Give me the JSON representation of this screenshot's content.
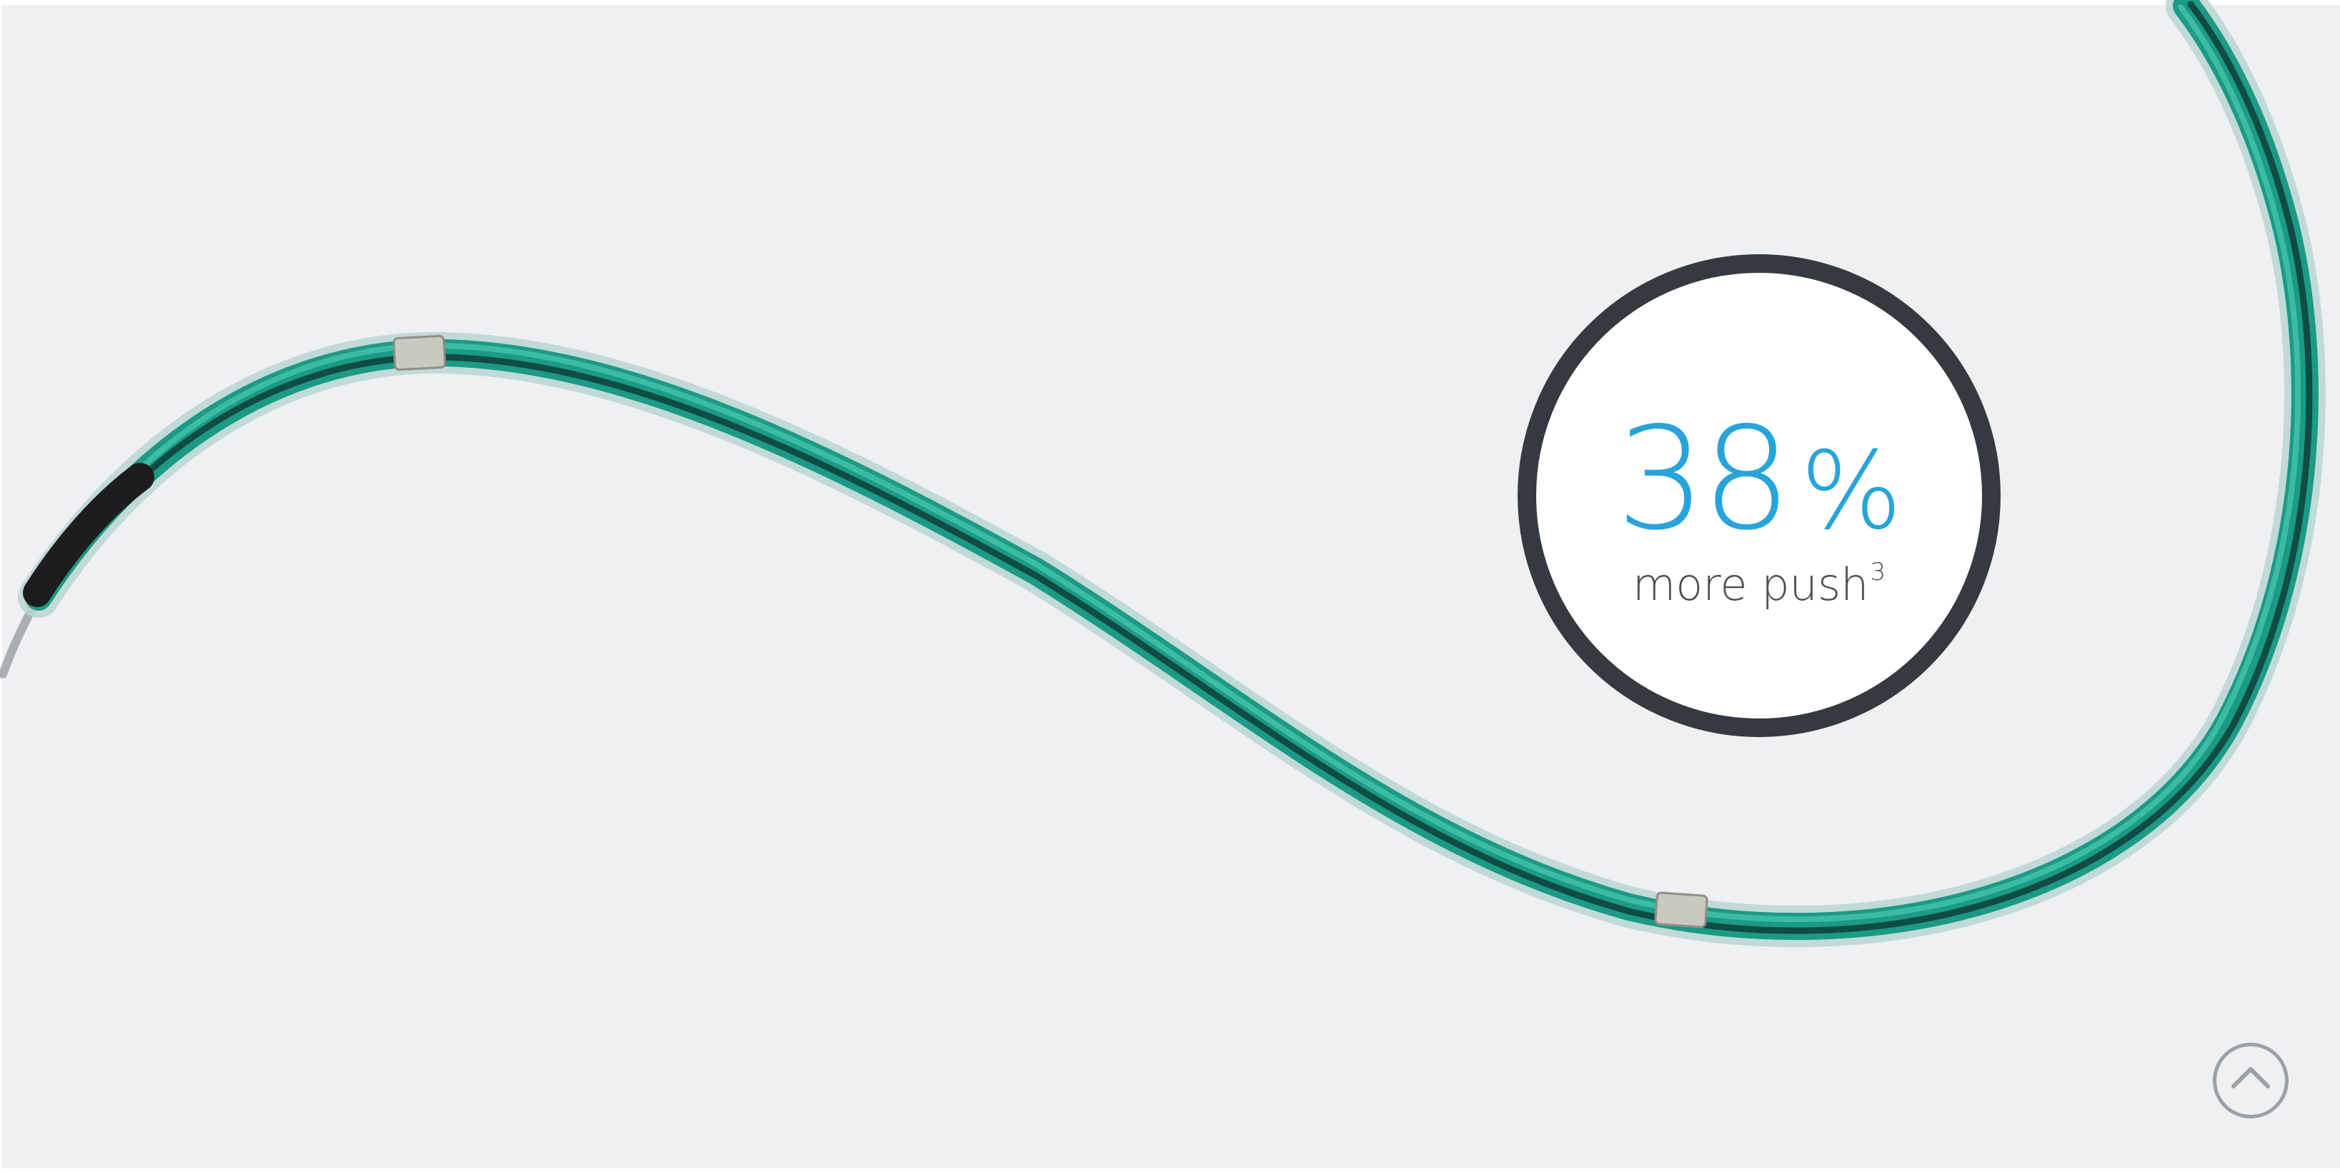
{
  "stat": {
    "number": "38",
    "unit": "%",
    "caption": "more push",
    "footnote": "3"
  },
  "colors": {
    "background": "#eff0f1",
    "accent": "#27a4dc",
    "ring": "#343a40",
    "catheter": "#1b9a86",
    "caption": "#4a4f55"
  },
  "icons": {
    "scroll_top": "chevron-up-icon"
  }
}
